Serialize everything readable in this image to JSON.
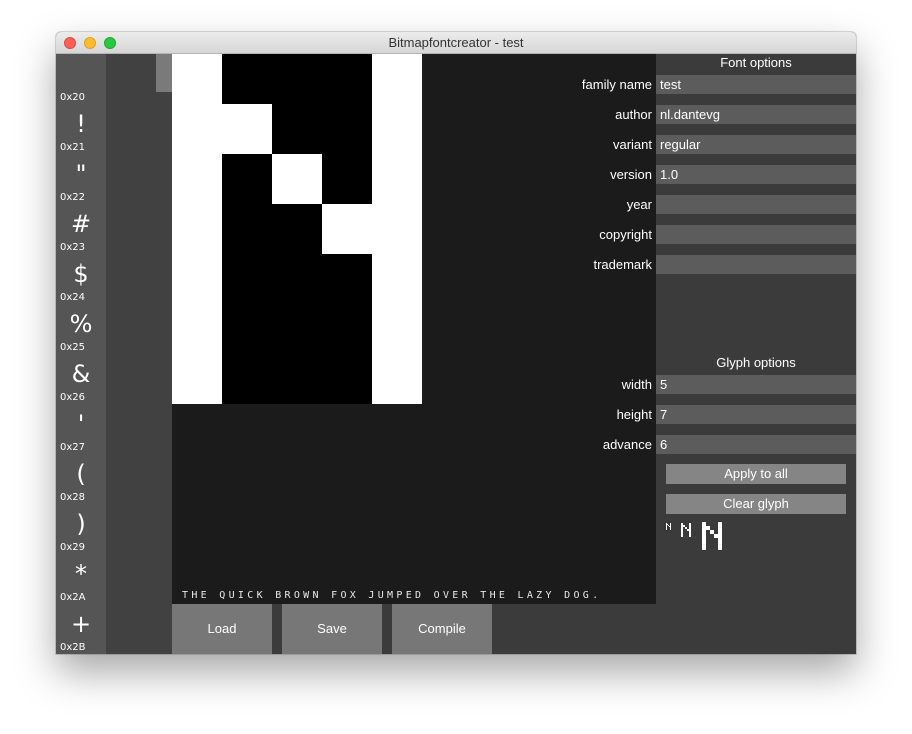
{
  "window": {
    "title": "Bitmapfontcreator - test"
  },
  "glyph_list": [
    {
      "char": "",
      "code": "0x20"
    },
    {
      "char": "!",
      "code": "0x21"
    },
    {
      "char": "\"",
      "code": "0x22"
    },
    {
      "char": "#",
      "code": "0x23"
    },
    {
      "char": "$",
      "code": "0x24"
    },
    {
      "char": "%",
      "code": "0x25"
    },
    {
      "char": "&",
      "code": "0x26"
    },
    {
      "char": "'",
      "code": "0x27"
    },
    {
      "char": "(",
      "code": "0x28"
    },
    {
      "char": ")",
      "code": "0x29"
    },
    {
      "char": "*",
      "code": "0x2A"
    },
    {
      "char": "+",
      "code": "0x2B"
    }
  ],
  "editor": {
    "pixels": [
      [
        1,
        0,
        0,
        0,
        1
      ],
      [
        1,
        1,
        0,
        0,
        1
      ],
      [
        1,
        0,
        1,
        0,
        1
      ],
      [
        1,
        0,
        0,
        1,
        1
      ],
      [
        1,
        0,
        0,
        0,
        1
      ],
      [
        1,
        0,
        0,
        0,
        1
      ],
      [
        1,
        0,
        0,
        0,
        1
      ]
    ],
    "preview_text": "THE QUICK BROWN FOX JUMPED OVER THE LAZY DOG."
  },
  "bottom": {
    "load": "Load",
    "save": "Save",
    "compile": "Compile"
  },
  "font_options": {
    "title": "Font options",
    "family_name": {
      "label": "family name",
      "value": "test"
    },
    "author": {
      "label": "author",
      "value": "nl.dantevg"
    },
    "variant": {
      "label": "variant",
      "value": "regular"
    },
    "version": {
      "label": "version",
      "value": "1.0"
    },
    "year": {
      "label": "year",
      "value": ""
    },
    "copyright": {
      "label": "copyright",
      "value": ""
    },
    "trademark": {
      "label": "trademark",
      "value": ""
    }
  },
  "glyph_options": {
    "title": "Glyph options",
    "width": {
      "label": "width",
      "value": "5"
    },
    "height": {
      "label": "height",
      "value": "7"
    },
    "advance": {
      "label": "advance",
      "value": "6"
    },
    "apply_all": "Apply to all",
    "clear_glyph": "Clear glyph"
  },
  "colors": {
    "panel": "#3b3b3b",
    "editor_bg": "#1b1b1b",
    "field_bg": "#5c5c5c",
    "button_bg": "#777777"
  }
}
